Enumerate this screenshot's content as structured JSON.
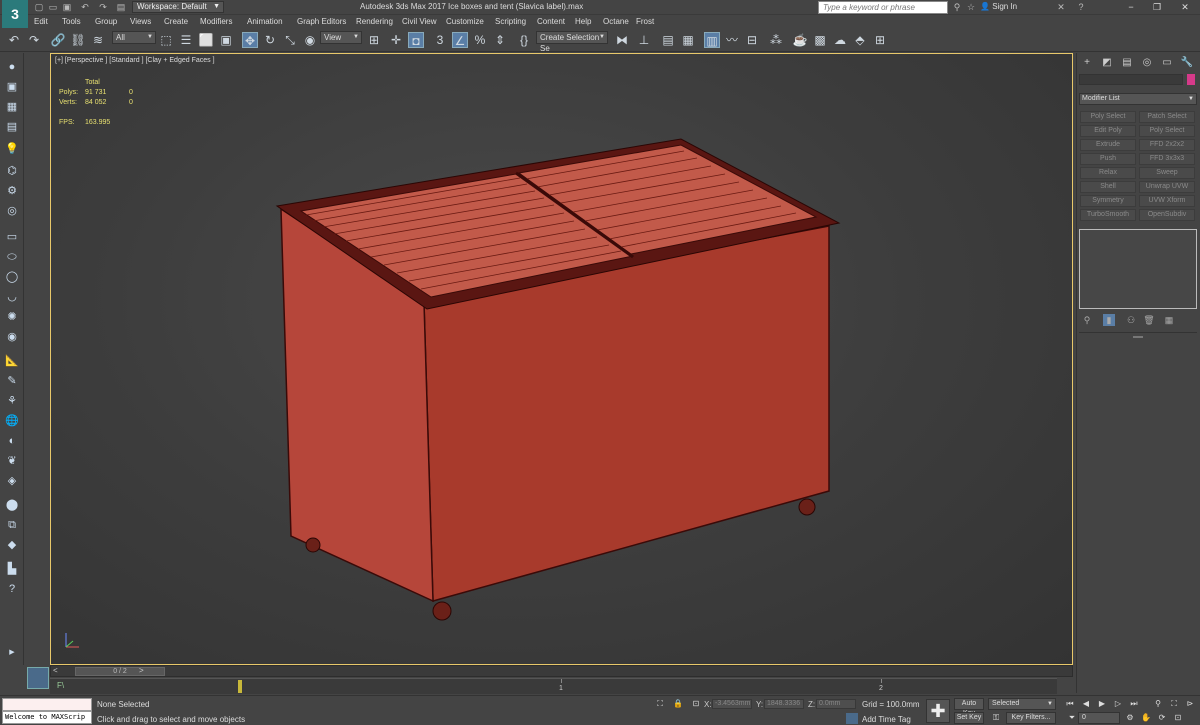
{
  "titlebar": {
    "logo": "3",
    "workspace": "Workspace: Default",
    "title": "Autodesk 3ds Max 2017     Ice boxes and tent (Slavica label).max",
    "search_placeholder": "Type a keyword or phrase",
    "sign_in": "Sign In"
  },
  "menu": [
    "Edit",
    "Tools",
    "Group",
    "Views",
    "Create",
    "Modifiers",
    "Animation",
    "Graph Editors",
    "Rendering",
    "Civil View",
    "Customize",
    "Scripting",
    "Content",
    "Help",
    "Octane",
    "Frost"
  ],
  "toolbar": {
    "selection_filter": "All",
    "ref_coord": "View",
    "named_selection": "Create Selection Se"
  },
  "viewport": {
    "label": "[+] [Perspective ] [Standard ] [Clay + Edged Faces ]",
    "stats": {
      "total_label": "Total",
      "polys_label": "Polys:",
      "polys_value": "91 731",
      "polys_sel": "0",
      "verts_label": "Verts:",
      "verts_value": "84 052",
      "verts_sel": "0",
      "fps_label": "FPS:",
      "fps_value": "163.995"
    }
  },
  "timeslider": {
    "frame": "0 / 2",
    "prev": "<",
    "next": ">"
  },
  "trackbar": {
    "fx_label": "F\\",
    "ticks": [
      "1",
      "2"
    ]
  },
  "status": {
    "maxscript_output": "Welcome to MAXScrip",
    "selection": "None Selected",
    "prompt": "Click and drag to select and move objects",
    "x_label": "X:",
    "x_value": "-3.4563mm",
    "y_label": "Y:",
    "y_value": "1848.3336",
    "z_label": "Z:",
    "z_value": "0.0mm",
    "grid": "Grid = 100.0mm",
    "add_time_tag": "Add Time Tag",
    "auto_key": "Auto Key",
    "set_key": "Set Key",
    "key_mode": "Selected",
    "key_filters": "Key Filters...",
    "current_frame": "0"
  },
  "cmdpanel": {
    "modifier_list": "Modifier List",
    "modifiers": [
      [
        "Poly Select",
        "Patch Select"
      ],
      [
        "Edit Poly",
        "Poly Select"
      ],
      [
        "Extrude",
        "FFD 2x2x2"
      ],
      [
        "Push",
        "FFD 3x3x3"
      ],
      [
        "Relax",
        "Sweep"
      ],
      [
        "Shell",
        "Unwrap UVW"
      ],
      [
        "Symmetry",
        "UVW Xform"
      ],
      [
        "TurboSmooth",
        "OpenSubdiv"
      ]
    ]
  },
  "colors": {
    "model_body": "#a83a2c",
    "model_outline": "#3a0a08",
    "viewport_border": "#e8c86a",
    "stats_text": "#e8e070"
  }
}
